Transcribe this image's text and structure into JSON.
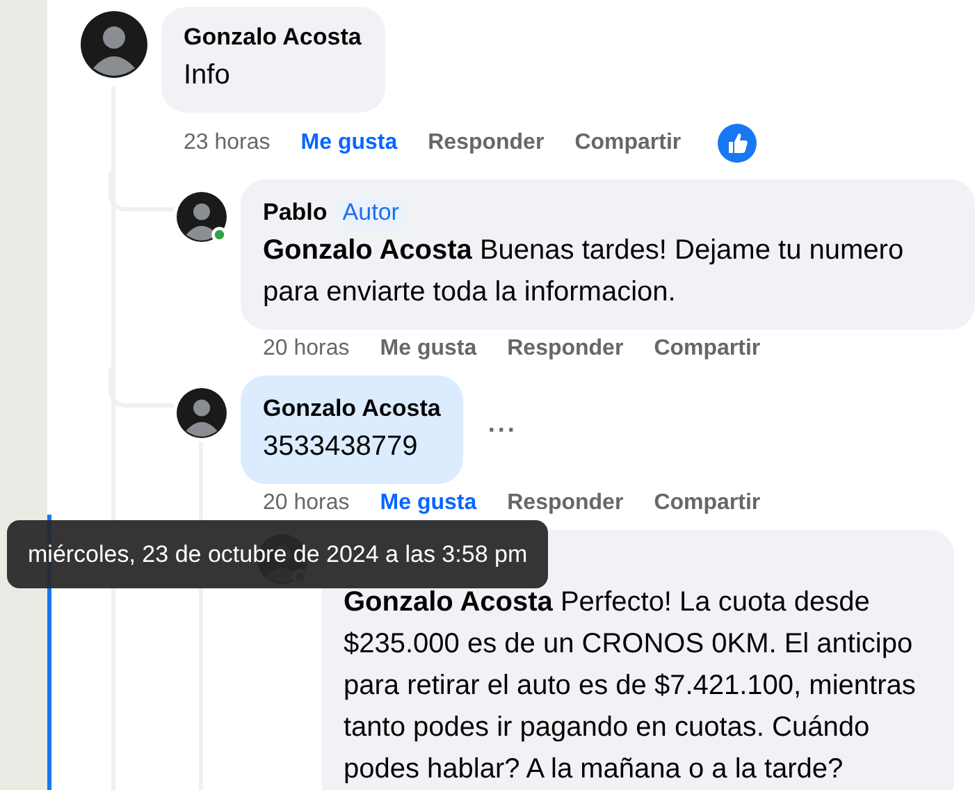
{
  "comments": [
    {
      "author": "Gonzalo Acosta",
      "text": "Info",
      "online": false,
      "time": "23 horas",
      "like": "Me gusta",
      "liked": true,
      "reply": "Responder",
      "share": "Compartir",
      "reacted": true,
      "replies": [
        {
          "author": "Pablo",
          "badge": "Autor",
          "mention": "Gonzalo Acosta",
          "text": "Buenas tardes! Dejame tu numero para enviarte toda la informacion.",
          "online": true,
          "time": "20 horas",
          "like": "Me gusta",
          "liked": false,
          "reply": "Responder",
          "share": "Compartir"
        },
        {
          "author": "Gonzalo Acosta",
          "text": "3533438779",
          "highlighted": true,
          "online": false,
          "more": "···",
          "time": "20 horas",
          "like": "Me gusta",
          "liked": true,
          "reply": "Responder",
          "share": "Compartir",
          "replies": [
            {
              "mention": "Gonzalo Acosta",
              "text": "Perfecto! La cuota desde $235.000 es de un CRONOS 0KM. El anticipo para retirar el auto es de $7.421.100, mientras tanto podes ir pagando en cuotas. Cuándo podes hablar? A la mañana o a la tarde?",
              "online": true
            }
          ]
        }
      ]
    }
  ],
  "tooltip": "miércoles, 23 de octubre de 2024 a las 3:58 pm"
}
